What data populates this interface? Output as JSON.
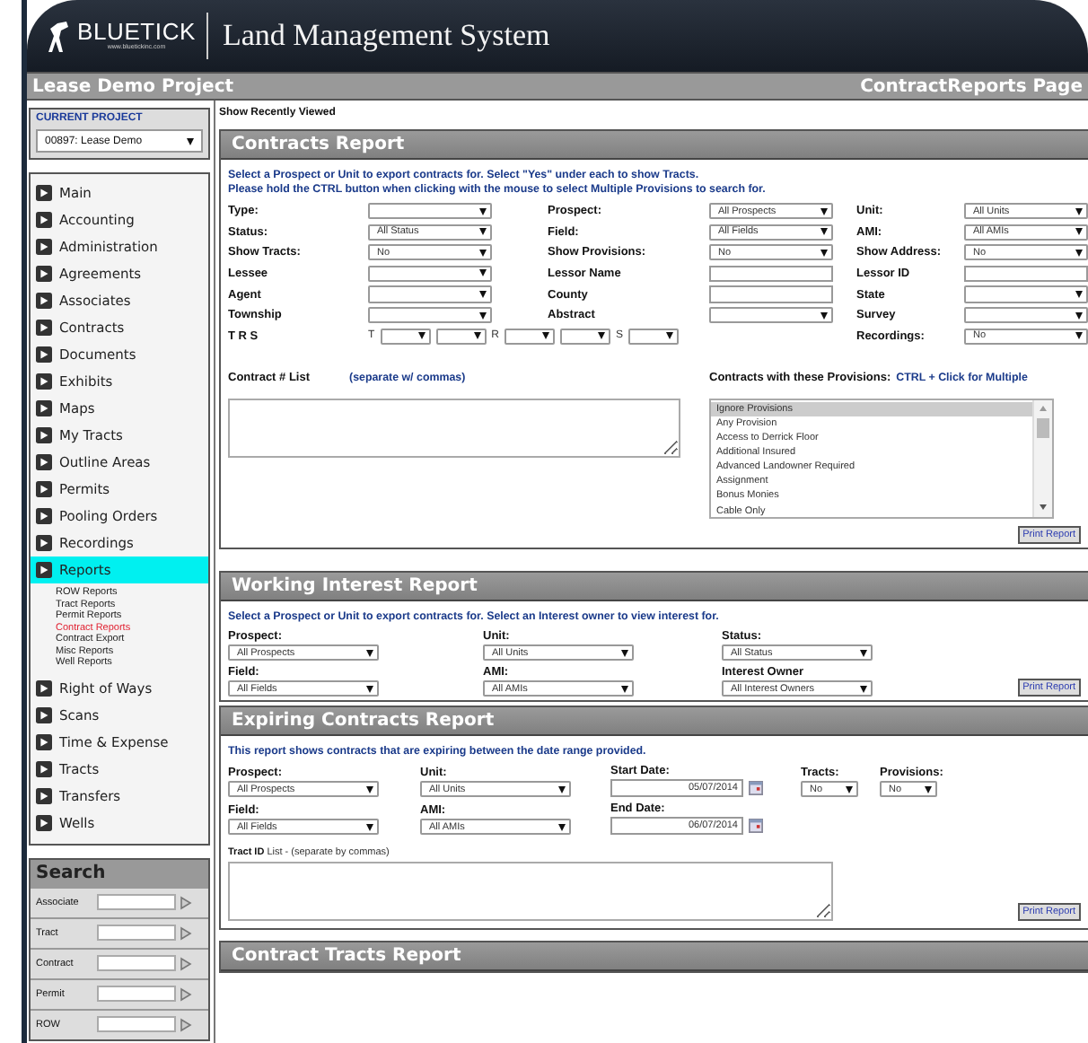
{
  "header": {
    "logo": "BLUETICK",
    "logo_sub": "www.bluetickinc.com",
    "system_title": "Land Management System"
  },
  "title_bar": {
    "project": "Lease Demo Project",
    "page": "ContractReports Page"
  },
  "sidebar": {
    "current_project_label": "CURRENT PROJECT",
    "project": "00897: Lease Demo",
    "nav": [
      {
        "label": "Main",
        "selected": false
      },
      {
        "label": "Accounting",
        "selected": false
      },
      {
        "label": "Administration",
        "selected": false
      },
      {
        "label": "Agreements",
        "selected": false
      },
      {
        "label": "Associates",
        "selected": false
      },
      {
        "label": "Contracts",
        "selected": false
      },
      {
        "label": "Documents",
        "selected": false
      },
      {
        "label": "Exhibits",
        "selected": false
      },
      {
        "label": "Maps",
        "selected": false
      },
      {
        "label": "My Tracts",
        "selected": false
      },
      {
        "label": "Outline Areas",
        "selected": false
      },
      {
        "label": "Permits",
        "selected": false
      },
      {
        "label": "Pooling Orders",
        "selected": false
      },
      {
        "label": "Recordings",
        "selected": false
      },
      {
        "label": "Reports",
        "selected": true,
        "children": [
          {
            "label": "ROW Reports",
            "selected": false
          },
          {
            "label": "Tract Reports",
            "selected": false
          },
          {
            "label": "Permit Reports",
            "selected": false
          },
          {
            "label": "Contract Reports",
            "selected": true
          },
          {
            "label": "Contract Export",
            "selected": false
          },
          {
            "label": "Misc Reports",
            "selected": false
          },
          {
            "label": "Well Reports",
            "selected": false
          }
        ]
      },
      {
        "label": "Right of Ways",
        "selected": false
      },
      {
        "label": "Scans",
        "selected": false
      },
      {
        "label": "Time & Expense",
        "selected": false
      },
      {
        "label": "Tracts",
        "selected": false
      },
      {
        "label": "Transfers",
        "selected": false
      },
      {
        "label": "Wells",
        "selected": false
      }
    ],
    "search": {
      "title": "Search",
      "fields": [
        {
          "label": "Associate"
        },
        {
          "label": "Tract"
        },
        {
          "label": "Contract"
        },
        {
          "label": "Permit"
        },
        {
          "label": "ROW"
        }
      ]
    }
  },
  "recently_viewed": "Show Recently Viewed",
  "contracts_report": {
    "title": "Contracts Report",
    "instructions": [
      "Select a Prospect or Unit to export contracts for. Select \"Yes\" under each to show Tracts.",
      "Please hold the CTRL button when clicking with the mouse to select Multiple Provisions to search for."
    ],
    "rows": [
      [
        {
          "label": "Type:",
          "kind": "select"
        },
        {
          "label": "Prospect:",
          "kind": "select",
          "value": "All Prospects"
        },
        {
          "label": "Unit:",
          "kind": "select",
          "value": "All Units"
        }
      ],
      [
        {
          "label": "Status:",
          "kind": "select",
          "value": "All Status"
        },
        {
          "label": "Field:",
          "kind": "select",
          "value": "All Fields"
        },
        {
          "label": "AMI:",
          "kind": "select",
          "value": "All AMIs"
        }
      ],
      [
        {
          "label": "Show Tracts:",
          "kind": "select",
          "value": "No"
        },
        {
          "label": "Show Provisions:",
          "kind": "select",
          "value": "No"
        },
        {
          "label": "Show Address:",
          "kind": "select",
          "value": "No"
        }
      ],
      [
        {
          "label": "Lessee",
          "kind": "select"
        },
        {
          "label": "Lessor Name",
          "kind": "text"
        },
        {
          "label": "Lessor ID",
          "kind": "text"
        }
      ],
      [
        {
          "label": "Agent",
          "kind": "select"
        },
        {
          "label": "County",
          "kind": "text"
        },
        {
          "label": "State",
          "kind": "select"
        }
      ],
      [
        {
          "label": "Township",
          "kind": "select"
        },
        {
          "label": "Abstract",
          "kind": "select"
        },
        {
          "label": "Survey",
          "kind": "select"
        }
      ],
      [
        {
          "label": "T R S",
          "kind": "trs",
          "parts": [
            {
              "kind": "select",
              "prefix": "T"
            },
            {
              "kind": "select"
            },
            {
              "kind": "select",
              "prefix": "R"
            },
            {
              "kind": "select"
            },
            {
              "kind": "select",
              "prefix": "S"
            }
          ]
        },
        {
          "kind": "blank"
        },
        {
          "label": "Recordings:",
          "kind": "select",
          "value": "No"
        }
      ]
    ],
    "contract_list": {
      "label": "Contract # List",
      "hint": "(separate w/ commas)"
    },
    "provisions": {
      "label": "Contracts with these Provisions:",
      "hint": "CTRL + Click for Multiple",
      "options": [
        {
          "label": "Ignore Provisions",
          "selected": true
        },
        {
          "label": "Any Provision",
          "selected": false
        },
        {
          "label": "Access to Derrick Floor",
          "selected": false
        },
        {
          "label": "Additional Insured",
          "selected": false
        },
        {
          "label": "Advanced Landowner Required",
          "selected": false
        },
        {
          "label": "Assignment",
          "selected": false
        },
        {
          "label": "Bonus Monies",
          "selected": false
        },
        {
          "label": "Cable Only",
          "selected": false
        }
      ]
    },
    "print_button": "Print Report"
  },
  "working_interest_report": {
    "title": "Working Interest Report",
    "instructions": "Select a Prospect or Unit to export contracts for. Select an Interest owner to view interest for.",
    "rows": [
      [
        {
          "label": "Prospect:",
          "value": "All Prospects"
        },
        {
          "label": "Unit:",
          "value": "All Units"
        },
        {
          "label": "Status:",
          "value": "All Status"
        }
      ],
      [
        {
          "label": "Field:",
          "value": "All Fields"
        },
        {
          "label": "AMI:",
          "value": "All AMIs"
        },
        {
          "label": "Interest Owner",
          "value": "All Interest Owners"
        }
      ]
    ],
    "print_button": "Print Report"
  },
  "expiring_contracts_report": {
    "title": "Expiring Contracts Report",
    "instructions": "This report shows contracts that are expiring between the date range provided.",
    "rows": [
      [
        {
          "label": "Prospect:",
          "kind": "select",
          "value": "All Prospects"
        },
        {
          "label": "Unit:",
          "kind": "select",
          "value": "All Units"
        },
        {
          "label": "Start Date:",
          "kind": "date",
          "value": "05/07/2014"
        },
        {
          "label": "Tracts:",
          "kind": "select",
          "value": "No"
        },
        {
          "label": "Provisions:",
          "kind": "select",
          "value": "No"
        }
      ],
      [
        {
          "label": "Field:",
          "kind": "select",
          "value": "All Fields"
        },
        {
          "label": "AMI:",
          "kind": "select",
          "value": "All AMIs"
        },
        {
          "label": "End Date:",
          "kind": "date",
          "value": "06/07/2014"
        }
      ]
    ],
    "tract_list_label": "**Tract ID** List - (separate by commas)",
    "print_button": "Print Report"
  },
  "contract_tracts_report": {
    "title": "Contract Tracts Report"
  }
}
